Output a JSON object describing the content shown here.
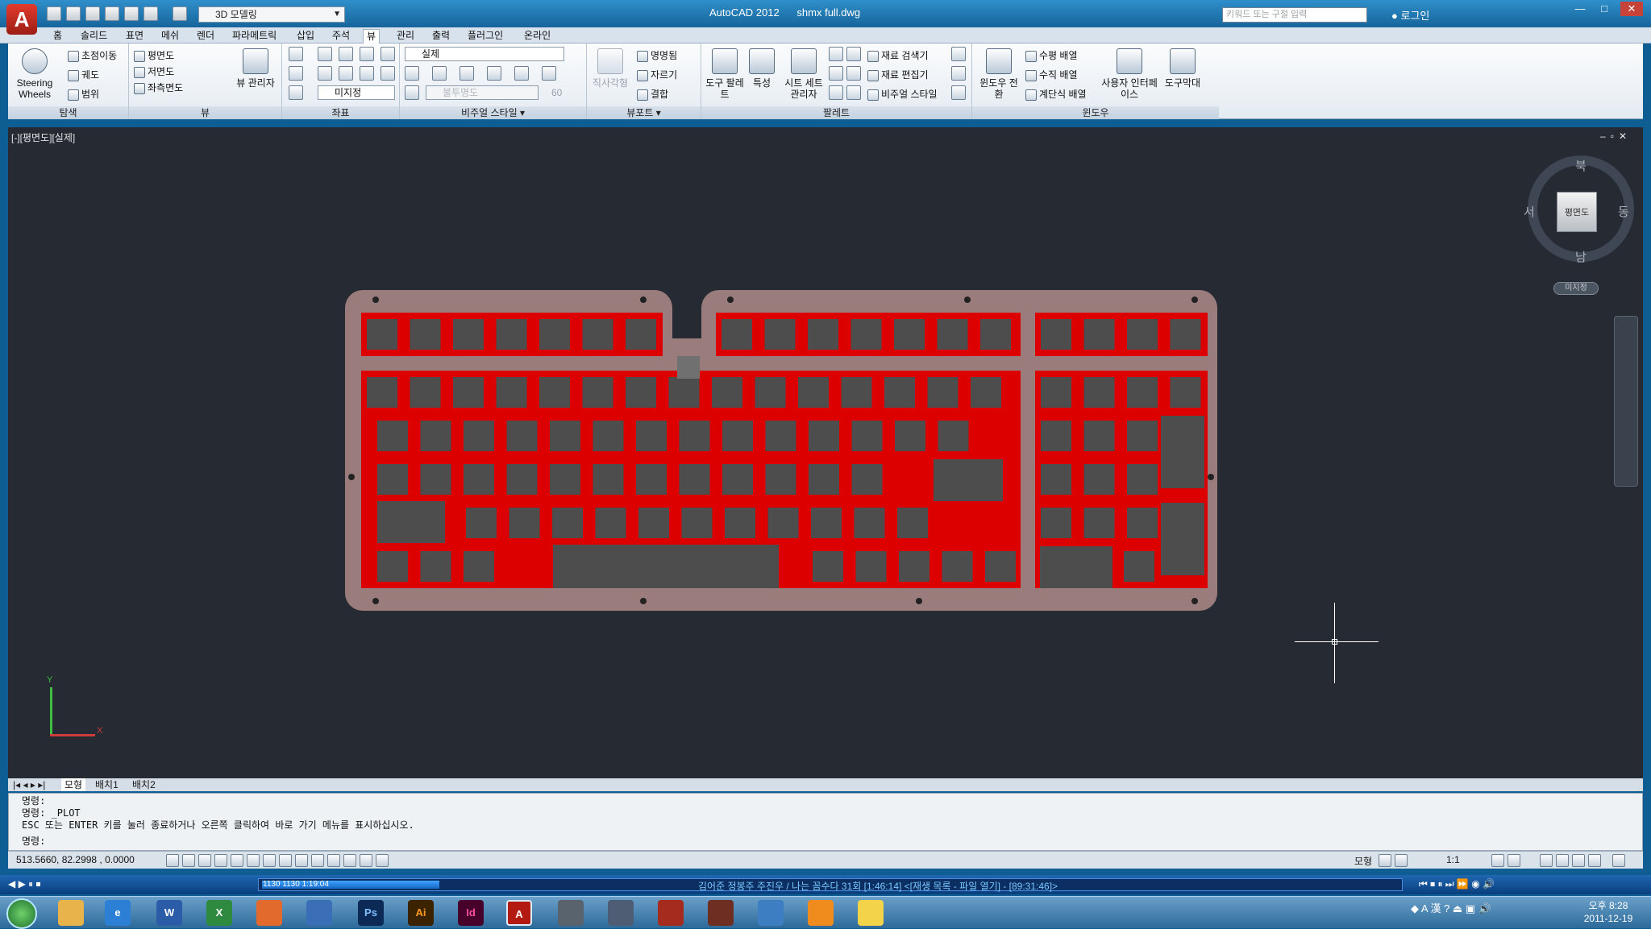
{
  "titlebar": {
    "app_name": "AutoCAD 2012",
    "file_name": "shmx full.dwg",
    "workspace": "3D 모델링",
    "search_placeholder": "키워드 또는 구절 입력",
    "login": "로그인"
  },
  "ribbon_tabs": [
    "홈",
    "솔리드",
    "표면",
    "메쉬",
    "렌더",
    "파라메트릭",
    "삽입",
    "주석",
    "뷰",
    "관리",
    "출력",
    "플러그인",
    "온라인"
  ],
  "active_tab": "뷰",
  "panels": {
    "navigate": {
      "title": "탐색",
      "steering": "Steering Wheels",
      "pan": "초점이동",
      "orbit": "궤도",
      "extents": "범위"
    },
    "views": {
      "title": "뷰",
      "items": [
        "평면도",
        "저면도",
        "좌측면도"
      ],
      "manager": "뷰 관리자"
    },
    "coordinates": {
      "title": "좌표",
      "world": "미지정"
    },
    "visual_styles": {
      "title": "비주얼 스타일",
      "current": "실제",
      "opacity_label": "불투명도",
      "opacity_value": "60"
    },
    "viewports": {
      "title": "뷰포트",
      "named": "명명됨",
      "clip": "자르기",
      "join": "결합",
      "rectangular": "직사각형"
    },
    "palettes": {
      "title": "팔레트",
      "tool_palettes": "도구 팔레트",
      "properties": "특성",
      "sheet_set": "시트 세트 관리자",
      "material_browser": "재료 검색기",
      "material_editor": "재료 편집기",
      "visual_styles": "비주얼 스타일"
    },
    "windows": {
      "title": "윈도우",
      "switch": "윈도우 전환",
      "tile_h": "수평 배열",
      "tile_v": "수직 배열",
      "cascade": "계단식 배열",
      "ui": "사용자 인터페이스",
      "toolbars": "도구막대"
    }
  },
  "viewport": {
    "label": "[-][평면도][실제]",
    "viewcube": {
      "face": "평면도",
      "north": "북",
      "south": "남",
      "east": "동",
      "west": "서",
      "ucs": "미지정"
    },
    "ucs_x": "X",
    "ucs_y": "Y"
  },
  "layout_tabs": [
    "모형",
    "배치1",
    "배치2"
  ],
  "command_line": [
    "명령:",
    "명령: _PLOT",
    "ESC 또는 ENTER 키를 눌러 종료하거나 오른쪽 클릭하여 바로 가기 메뉴를 표시하십시오.",
    "명령:"
  ],
  "status": {
    "coordinates": "513.5660, 82.2998 , 0.0000",
    "model": "모형",
    "scale": "1:1"
  },
  "media": {
    "title": "김어준 정봉주 주진우 / 나는 꼼수다 31회 [1:46:14]     <[재생 목록 - 파일 열기] - [89:31:46]>",
    "time": "1130  1130  1:19:04"
  },
  "taskbar": {
    "apps": [
      "W",
      "X",
      "Ps",
      "Ai",
      "Id"
    ],
    "clock_time": "오후 8:28",
    "clock_date": "2011-12-19"
  },
  "colors": {
    "plate": "#9a7c7c",
    "cutout": "#dd0000",
    "key": "#4d4d4d",
    "canvas": "#252a33"
  },
  "drawing": {
    "description_free": true,
    "rows": [
      {
        "keys": 15
      },
      {
        "keys": 15
      },
      {
        "keys": 14
      },
      {
        "keys": 13
      },
      {
        "keys": 12
      },
      {
        "keys": 8
      }
    ]
  }
}
